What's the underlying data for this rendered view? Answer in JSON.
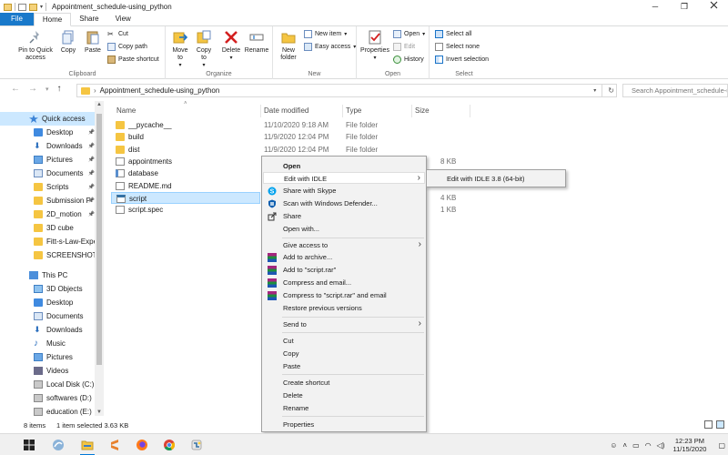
{
  "window": {
    "title": "Appointment_schedule-using_python",
    "controls": {
      "minimize": "─",
      "maximize": "❐",
      "close": ""
    }
  },
  "ribbon_tabs": [
    "File",
    "Home",
    "Share",
    "View"
  ],
  "ribbon": {
    "clipboard": {
      "label": "Clipboard",
      "pin": "Pin to Quick access",
      "copy": "Copy",
      "paste": "Paste",
      "cut": "Cut",
      "copy_path": "Copy path",
      "paste_shortcut": "Paste shortcut"
    },
    "organize": {
      "label": "Organize",
      "move_to": "Move to",
      "copy_to": "Copy to",
      "delete": "Delete",
      "rename": "Rename"
    },
    "new": {
      "label": "New",
      "new_folder": "New folder",
      "new_item": "New item",
      "easy_access": "Easy access"
    },
    "open": {
      "label": "Open",
      "properties": "Properties",
      "open": "Open",
      "edit": "Edit",
      "history": "History"
    },
    "select": {
      "label": "Select",
      "select_all": "Select all",
      "select_none": "Select none",
      "invert": "Invert selection"
    }
  },
  "address": {
    "path": "Appointment_schedule-using_python",
    "search_placeholder": "Search Appointment_schedule-using_python"
  },
  "nav_pane": [
    {
      "label": "Quick access",
      "icon": "star-icon",
      "selected": true,
      "pinned": false,
      "indent": 0
    },
    {
      "label": "Desktop",
      "icon": "desktop-icon",
      "pinned": true,
      "indent": 1
    },
    {
      "label": "Downloads",
      "icon": "download-icon",
      "pinned": true,
      "indent": 1
    },
    {
      "label": "Pictures",
      "icon": "pictures-icon",
      "pinned": true,
      "indent": 1
    },
    {
      "label": "Documents",
      "icon": "documents-icon",
      "pinned": true,
      "indent": 1
    },
    {
      "label": "Scripts",
      "icon": "folder-icon",
      "pinned": true,
      "indent": 1
    },
    {
      "label": "Submission P",
      "icon": "folder-icon",
      "pinned": true,
      "indent": 1
    },
    {
      "label": "2D_motion",
      "icon": "folder-icon",
      "pinned": true,
      "indent": 1
    },
    {
      "label": "3D cube",
      "icon": "folder-icon",
      "pinned": false,
      "indent": 1
    },
    {
      "label": "Fitt-s-Law-Exper",
      "icon": "folder-icon",
      "pinned": false,
      "indent": 1
    },
    {
      "label": "SCREENSHOTS",
      "icon": "folder-icon",
      "pinned": false,
      "indent": 1
    },
    {
      "label": "This PC",
      "icon": "pc-icon",
      "pinned": false,
      "indent": 0
    },
    {
      "label": "3D Objects",
      "icon": "3d-objects-icon",
      "pinned": false,
      "indent": 1
    },
    {
      "label": "Desktop",
      "icon": "desktop-icon",
      "pinned": false,
      "indent": 1
    },
    {
      "label": "Documents",
      "icon": "documents-icon",
      "pinned": false,
      "indent": 1
    },
    {
      "label": "Downloads",
      "icon": "download-icon",
      "pinned": false,
      "indent": 1
    },
    {
      "label": "Music",
      "icon": "music-icon",
      "pinned": false,
      "indent": 1
    },
    {
      "label": "Pictures",
      "icon": "pictures-icon",
      "pinned": false,
      "indent": 1
    },
    {
      "label": "Videos",
      "icon": "videos-icon",
      "pinned": false,
      "indent": 1
    },
    {
      "label": "Local Disk (C:)",
      "icon": "drive-icon",
      "pinned": false,
      "indent": 1
    },
    {
      "label": "softwares (D:)",
      "icon": "drive-icon",
      "pinned": false,
      "indent": 1
    },
    {
      "label": "education (E:)",
      "icon": "drive-icon",
      "pinned": false,
      "indent": 1
    }
  ],
  "columns": [
    "Name",
    "Date modified",
    "Type",
    "Size"
  ],
  "files": [
    {
      "name": "__pycache__",
      "icon": "folder-icon",
      "date": "11/10/2020 9:18 AM",
      "type": "File folder",
      "size": ""
    },
    {
      "name": "build",
      "icon": "folder-icon",
      "date": "11/9/2020 12:04 PM",
      "type": "File folder",
      "size": ""
    },
    {
      "name": "dist",
      "icon": "folder-icon",
      "date": "11/9/2020 12:04 PM",
      "type": "File folder",
      "size": ""
    },
    {
      "name": "appointments",
      "icon": "text-file-icon",
      "date": "",
      "type": "",
      "size": "8 KB"
    },
    {
      "name": "database",
      "icon": "database-file-icon",
      "date": "",
      "type": "",
      "size": ""
    },
    {
      "name": "README.md",
      "icon": "file-icon",
      "date": "",
      "type": "",
      "size": ""
    },
    {
      "name": "script",
      "icon": "python-file-icon",
      "date": "",
      "type": "",
      "size": "4 KB",
      "selected": true
    },
    {
      "name": "script.spec",
      "icon": "file-icon",
      "date": "",
      "type": "",
      "size": "1 KB"
    }
  ],
  "context_menu": {
    "open": "Open",
    "edit_with_idle": "Edit with IDLE",
    "share_skype": "Share with Skype",
    "scan_defender": "Scan with Windows Defender...",
    "share": "Share",
    "open_with": "Open with...",
    "give_access": "Give access to",
    "add_archive": "Add to archive...",
    "add_rar": "Add to \"script.rar\"",
    "compress_email": "Compress and email...",
    "compress_rar_email": "Compress to \"script.rar\" and email",
    "restore": "Restore previous versions",
    "send_to": "Send to",
    "cut": "Cut",
    "copy": "Copy",
    "paste": "Paste",
    "create_shortcut": "Create shortcut",
    "delete": "Delete",
    "rename": "Rename",
    "properties": "Properties"
  },
  "submenu": {
    "edit_idle_38": "Edit with IDLE 3.8 (64-bit)"
  },
  "status": {
    "items": "8 items",
    "selected": "1 item selected  3.63 KB"
  },
  "taskbar": {
    "time": "12:23 PM",
    "date": "11/15/2020"
  },
  "colors": {
    "accent": "#1979ca",
    "selection": "#cce8ff",
    "menu_bg": "#f2f2f2"
  }
}
